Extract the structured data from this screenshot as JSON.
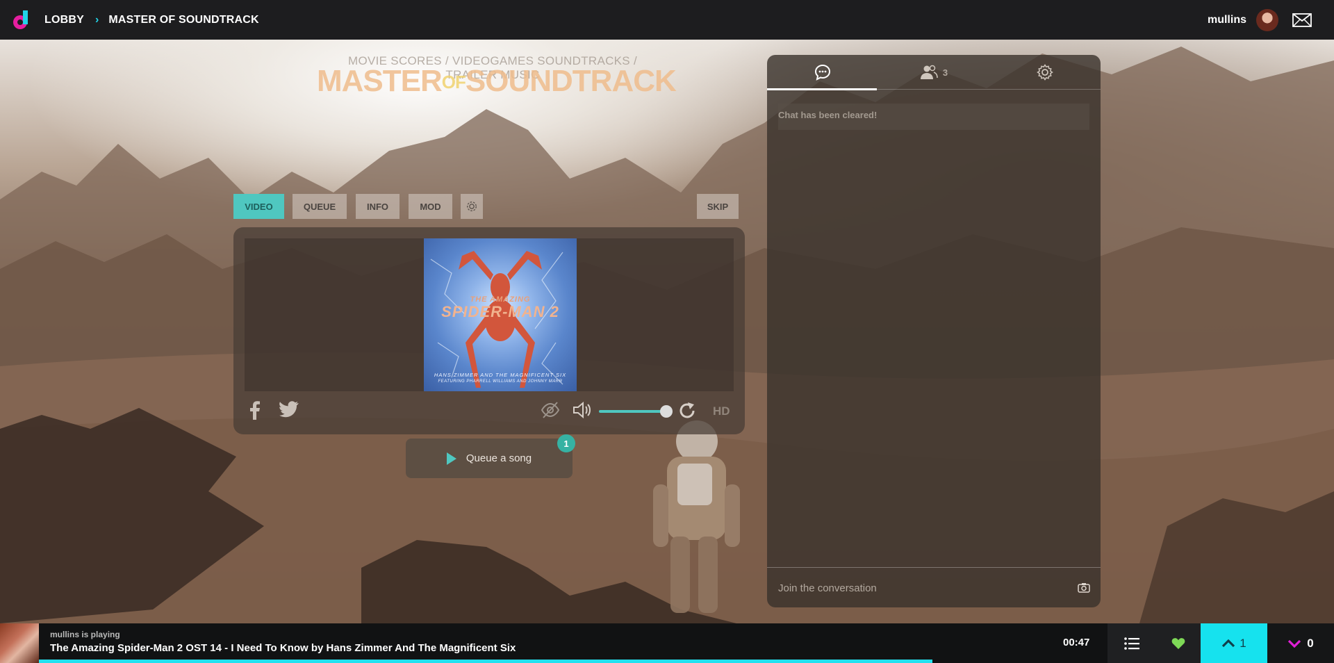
{
  "topbar": {
    "lobby": "LOBBY",
    "room": "MASTER OF SOUNDTRACK",
    "username": "mullins"
  },
  "room_logo": {
    "subtitle": "MOVIE SCORES / VIDEOGAMES SOUNDTRACKS / TRAILER MUSIC",
    "title_part1": "MASTER",
    "title_of": "OF",
    "title_part2": "SOUNDTRACK"
  },
  "player": {
    "tabs": [
      "VIDEO",
      "QUEUE",
      "INFO",
      "MOD"
    ],
    "active_tab": "VIDEO",
    "skip_label": "SKIP",
    "hd_label": "HD",
    "volume_level": 0.8,
    "cover": {
      "title_small": "THE AMAZING",
      "title_big": "SPIDER-MAN 2",
      "credit": "HANS ZIMMER AND THE MAGNIFICENT SIX",
      "credit2": "FEATURING PHARRELL WILLIAMS AND JOHNNY MARR"
    }
  },
  "queue": {
    "button_label": "Queue a song",
    "badge": "1"
  },
  "chat": {
    "user_count": "3",
    "system_message": "Chat has been cleared!",
    "input_placeholder": "Join the conversation"
  },
  "now_playing": {
    "label": "mullins is playing",
    "title": "The Amazing Spider-Man 2 OST 14 - I Need To Know by Hans Zimmer And The Magnificent Six",
    "time_remaining": "00:47",
    "woot_count": "1",
    "meh_count": "0",
    "progress": 0.69
  },
  "colors": {
    "accent_cyan": "#22e1ef",
    "accent_teal": "#4fc7c0",
    "grab_green": "#7ed957",
    "meh_magenta": "#e01fd6",
    "topbar_bg": "#1d1d1f"
  }
}
